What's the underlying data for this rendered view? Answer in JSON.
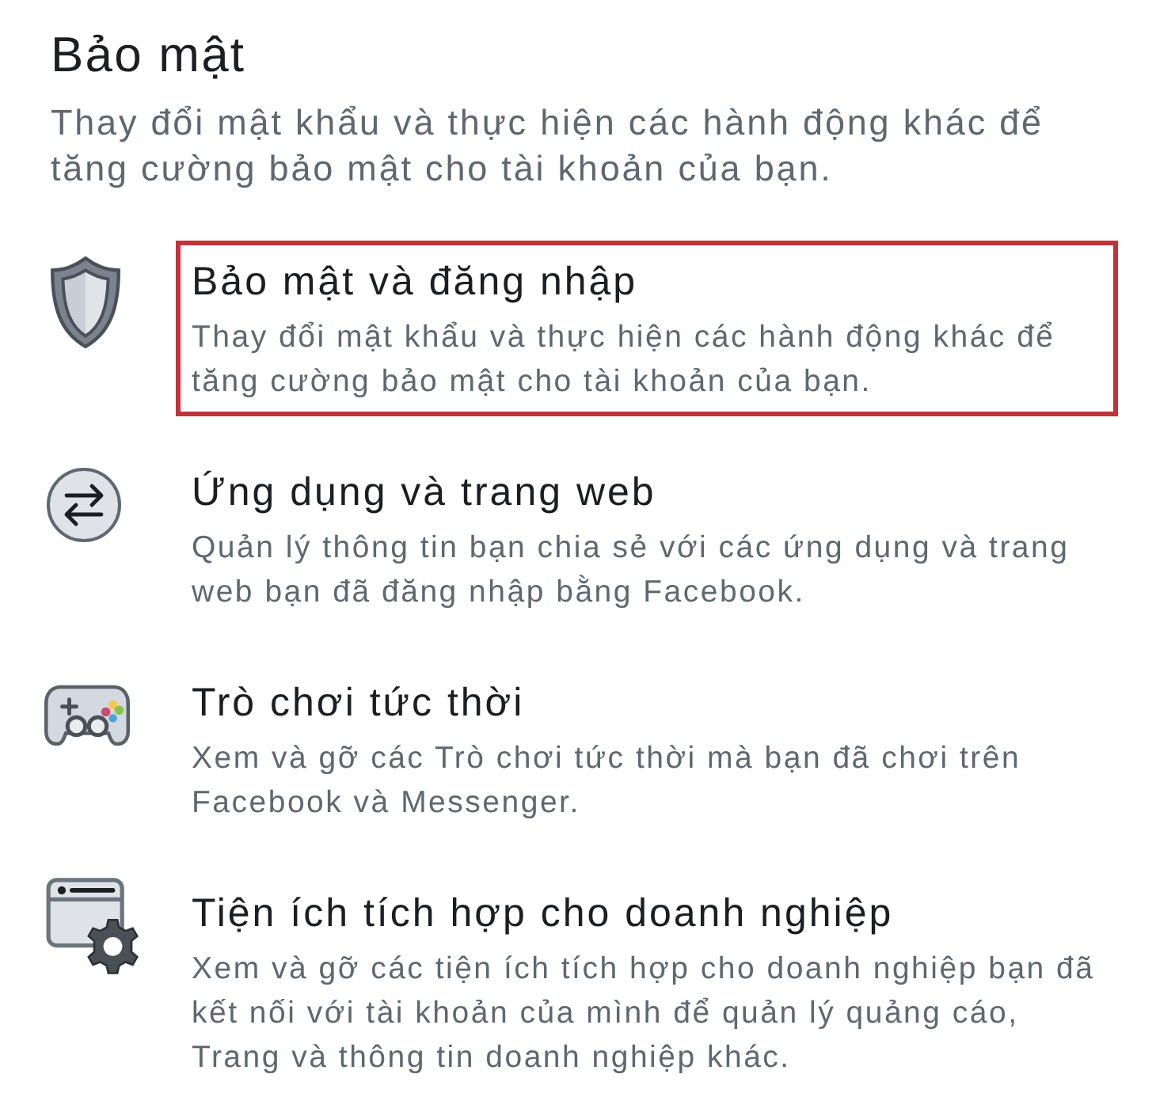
{
  "section": {
    "title": "Bảo mật",
    "description": "Thay đổi mật khẩu và thực hiện các hành động khác để tăng cường bảo mật cho tài khoản của bạn."
  },
  "items": [
    {
      "kind": "shield",
      "title": "Bảo mật và đăng nhập",
      "description": "Thay đổi mật khẩu và thực hiện các hành động khác để tăng cường bảo mật cho tài khoản của bạn.",
      "highlighted": true
    },
    {
      "kind": "apps",
      "title": "Ứng dụng và trang web",
      "description": "Quản lý thông tin bạn chia sẻ với các ứng dụng và trang web bạn đã đăng nhập bằng Facebook.",
      "highlighted": false
    },
    {
      "kind": "games",
      "title": "Trò chơi tức thời",
      "description": "Xem và gỡ các Trò chơi tức thời mà bạn đã chơi trên Facebook và Messenger.",
      "highlighted": false
    },
    {
      "kind": "business",
      "title": "Tiện ích tích hợp cho doanh nghiệp",
      "description": "Xem và gỡ các tiện ích tích hợp cho doanh nghiệp bạn đã kết nối với tài khoản của mình để quản lý quảng cáo, Trang và thông tin doanh nghiệp khác.",
      "highlighted": false
    }
  ]
}
